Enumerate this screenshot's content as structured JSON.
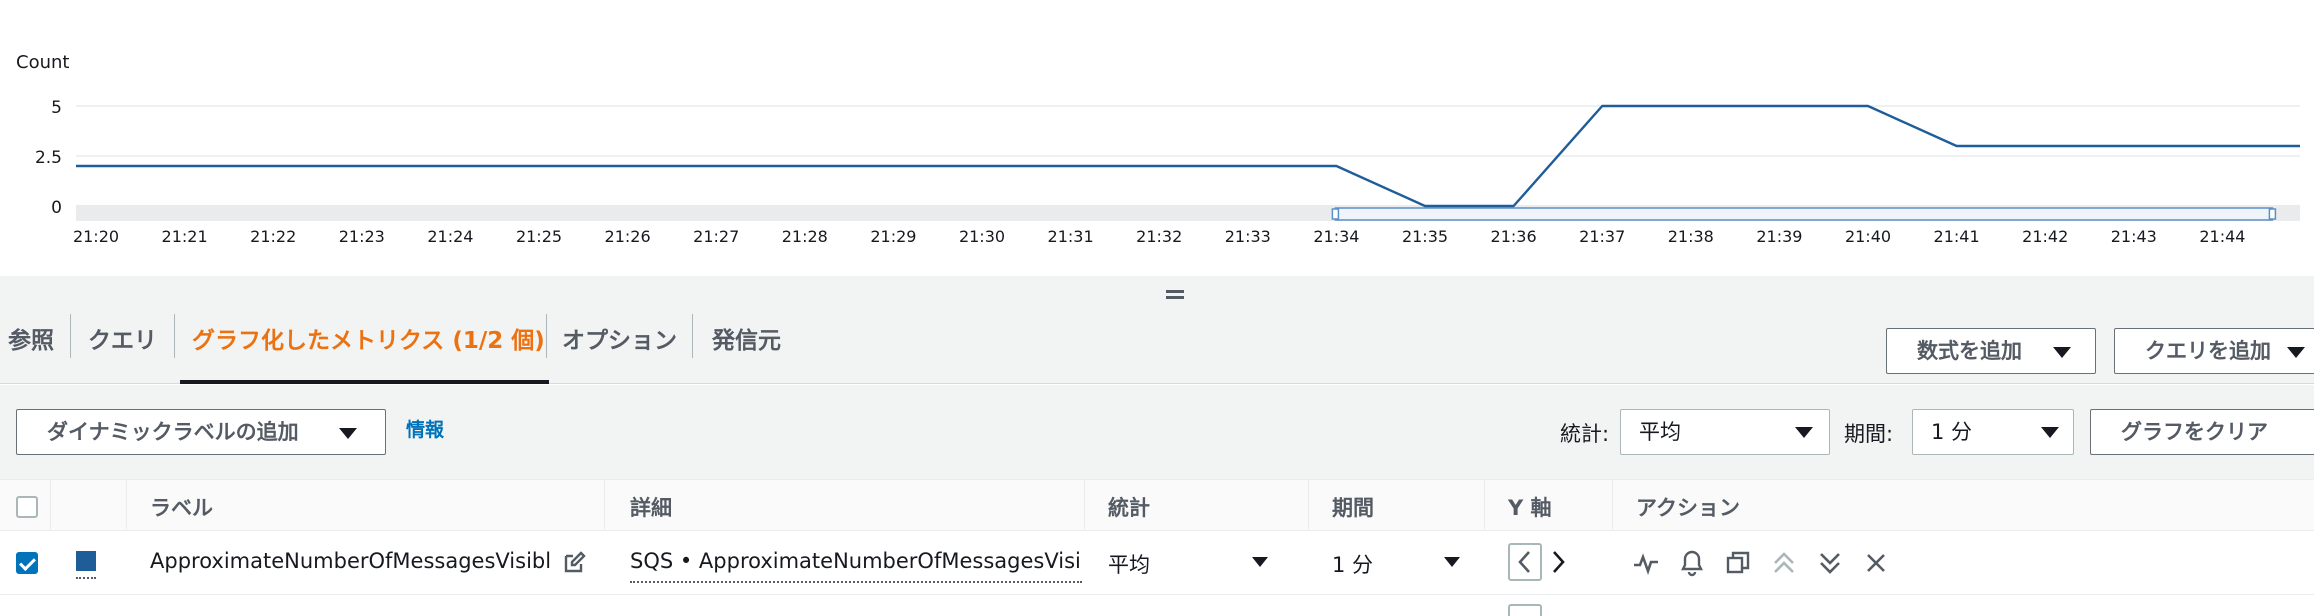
{
  "chart_data": {
    "type": "line",
    "ylabel": "Count",
    "y_ticks": [
      "5",
      "2.5",
      "0"
    ],
    "ylim": [
      0,
      5
    ],
    "x": [
      "21:20",
      "21:21",
      "21:22",
      "21:23",
      "21:24",
      "21:25",
      "21:26",
      "21:27",
      "21:28",
      "21:29",
      "21:30",
      "21:31",
      "21:32",
      "21:33",
      "21:34",
      "21:35",
      "21:36",
      "21:37",
      "21:38",
      "21:39",
      "21:40",
      "21:41",
      "21:42",
      "21:43",
      "21:44"
    ],
    "series": [
      {
        "color": "#1f5d99",
        "points": [
          [
            "21:20",
            2
          ],
          [
            "21:34",
            2
          ],
          [
            "21:35",
            0
          ],
          [
            "21:36",
            0
          ],
          [
            "21:37",
            5
          ],
          [
            "21:40",
            5
          ],
          [
            "21:41",
            3
          ],
          [
            "21:45",
            3
          ]
        ]
      }
    ],
    "grid": true,
    "range_selector": {
      "from": "21:34",
      "to": "21:44"
    }
  },
  "tabs": [
    {
      "label": "参照"
    },
    {
      "label": "クエリ"
    },
    {
      "label": "グラフ化したメトリクス (1/2 個)",
      "active": true
    },
    {
      "label": "オプション"
    },
    {
      "label": "発信元"
    }
  ],
  "tab_buttons": {
    "add_math": "数式を追加",
    "add_query": "クエリを追加"
  },
  "toolbar": {
    "dynamic_label_button": "ダイナミックラベルの追加",
    "info_link": "情報",
    "stat_label": "統計:",
    "stat_value": "平均",
    "period_label": "期間:",
    "period_value": "1 分",
    "clear_graph_button": "グラフをクリア"
  },
  "table": {
    "headers": {
      "label": "ラベル",
      "details": "詳細",
      "statistic": "統計",
      "period": "期間",
      "y_axis": "Y 軸",
      "actions": "アクション"
    },
    "rows": [
      {
        "checked": true,
        "color": "#1f5d99",
        "label": "ApproximateNumberOfMessagesVisible",
        "details": "SQS • ApproximateNumberOfMessagesVisible",
        "statistic": "平均",
        "period": "1 分"
      }
    ]
  },
  "colors": {
    "accent": "#ec7211",
    "link": "#0073bb",
    "series": "#1f5d99"
  }
}
